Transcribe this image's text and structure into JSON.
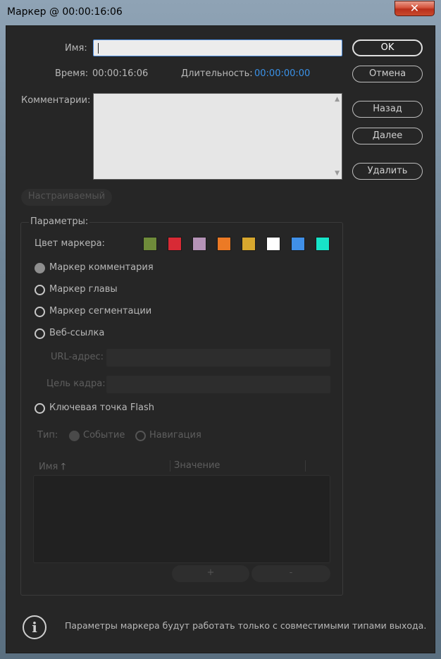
{
  "window": {
    "title": "Маркер @ 00:00:16:06",
    "close_label": "✕"
  },
  "form": {
    "name_label": "Имя:",
    "name_value": "",
    "time_label": "Время:",
    "time_value": "00:00:16:06",
    "duration_label": "Длительность:",
    "duration_value": "00:00:00:00",
    "comments_label": "Комментарии:",
    "comments_value": ""
  },
  "buttons": {
    "ok": "OK",
    "cancel": "Отмена",
    "back": "Назад",
    "next": "Далее",
    "delete": "Удалить",
    "custom": "Настраиваемый",
    "add": "+",
    "remove": "-"
  },
  "params": {
    "legend": "Параметры:",
    "color_label": "Цвет маркера:",
    "colors": [
      "#6f8b3a",
      "#d82a35",
      "#b593b7",
      "#ec7a25",
      "#d7a72e",
      "#ffffff",
      "#4090e8",
      "#17e4c8"
    ],
    "radios": [
      {
        "label": "Маркер комментария",
        "selected": true
      },
      {
        "label": "Маркер главы",
        "selected": false
      },
      {
        "label": "Маркер сегментации",
        "selected": false
      },
      {
        "label": "Веб-ссылка",
        "selected": false
      }
    ],
    "url_label": "URL-адрес:",
    "frame_target_label": "Цель кадра:",
    "flash_label": "Ключевая точка Flash",
    "type_label": "Тип:",
    "type_event": "Событие",
    "type_nav": "Навигация",
    "table": {
      "col_name": "Имя",
      "col_value": "Значение",
      "sort_icon": "arrow-up-icon"
    }
  },
  "info": {
    "icon": "info-icon",
    "text": "Параметры маркера будут работать только с совместимыми типами выхода."
  }
}
